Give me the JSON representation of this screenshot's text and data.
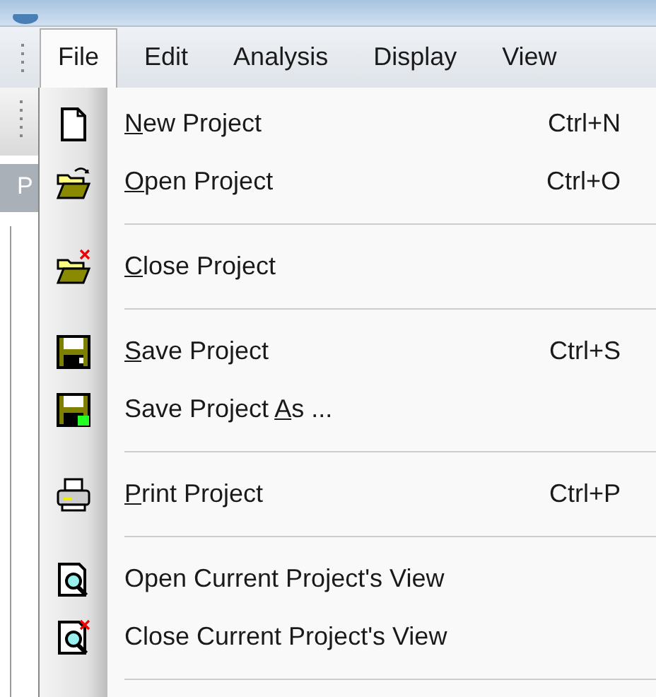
{
  "menu_bar": [
    {
      "label": "File",
      "selected": true
    },
    {
      "label": "Edit",
      "selected": false
    },
    {
      "label": "Analysis",
      "selected": false
    },
    {
      "label": "Display",
      "selected": false
    },
    {
      "label": "View",
      "selected": false
    }
  ],
  "side_panel": {
    "tab_label": "P"
  },
  "file_menu": [
    {
      "kind": "item",
      "label_parts": [
        {
          "text": "N",
          "underlined": true
        },
        {
          "text": "ew Project",
          "underlined": false
        }
      ],
      "shortcut": "Ctrl+N"
    },
    {
      "kind": "item",
      "label_parts": [
        {
          "text": "O",
          "underlined": true
        },
        {
          "text": "pen Project",
          "underlined": false
        }
      ],
      "shortcut": "Ctrl+O"
    },
    {
      "kind": "separator"
    },
    {
      "kind": "item",
      "label_parts": [
        {
          "text": "C",
          "underlined": true
        },
        {
          "text": "lose Project",
          "underlined": false
        }
      ]
    },
    {
      "kind": "separator"
    },
    {
      "kind": "item",
      "label_parts": [
        {
          "text": "S",
          "underlined": true
        },
        {
          "text": "ave Project",
          "underlined": false
        }
      ],
      "shortcut": "Ctrl+S"
    },
    {
      "kind": "item",
      "label_parts": [
        {
          "text": "Save Project ",
          "underlined": false
        },
        {
          "text": "A",
          "underlined": true
        },
        {
          "text": "s ...",
          "underlined": false
        }
      ]
    },
    {
      "kind": "separator"
    },
    {
      "kind": "item",
      "label_parts": [
        {
          "text": "P",
          "underlined": true
        },
        {
          "text": "rint Project",
          "underlined": false
        }
      ],
      "shortcut": "Ctrl+P"
    },
    {
      "kind": "separator"
    },
    {
      "kind": "item",
      "label_parts": [
        {
          "text": "Open Current Project's View",
          "underlined": false
        }
      ]
    },
    {
      "kind": "item",
      "label_parts": [
        {
          "text": "Close Current Project's View",
          "underlined": false
        }
      ]
    },
    {
      "kind": "separator"
    }
  ]
}
